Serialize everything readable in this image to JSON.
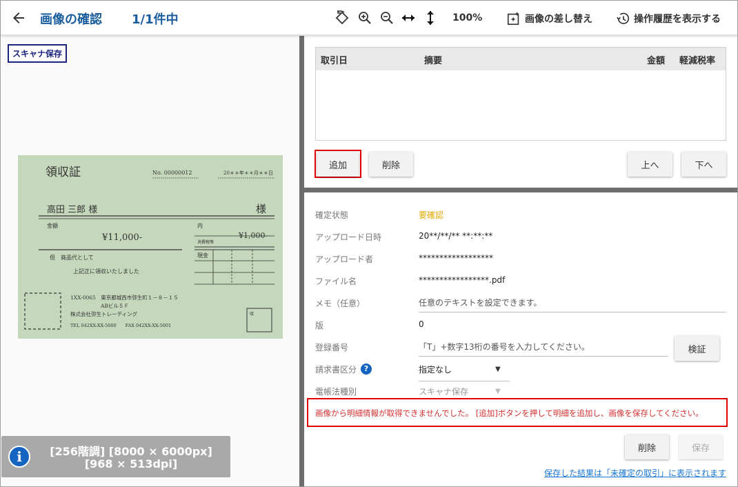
{
  "header": {
    "title": "画像の確認",
    "count": "1/1件中",
    "zoom": "100%",
    "replace_label": "画像の差し替え",
    "history_label": "操作履歴を表示する"
  },
  "left": {
    "badge": "スキャナ保存",
    "receipt": {
      "title": "領収証",
      "number": "No. 00000012",
      "date": "20＊＊年＊＊月＊＊日",
      "recipient": "高田 三郎 様",
      "honorific": "様",
      "amount_label": "金額",
      "amount": "¥11,000-",
      "inner_label": "内",
      "tax_label": "消費税等",
      "tax_amount": "¥1,000-",
      "cash_label": "現金",
      "proviso": "但　商品代として",
      "received": "上記正に領収いたしました",
      "address": "1XX-0065　東京都城西市弥生町１－８－１５",
      "building": "ABビル５Ｆ",
      "company": "株式会社弥生トレーディング",
      "tel": "TEL 042XX-XX-5000　　FAX 042XX-XX-5001",
      "stamp": "収"
    },
    "info_line1": "[256階調] [8000 × 6000px]",
    "info_line2": "[968 × 513dpi]"
  },
  "detail": {
    "columns": {
      "date": "取引日",
      "summary": "摘要",
      "amount": "金額",
      "tax_rate": "軽減税率"
    },
    "add_label": "追加",
    "delete_label": "削除",
    "up_label": "上へ",
    "down_label": "下へ"
  },
  "form": {
    "status_label": "確定状態",
    "status_value": "要確認",
    "upload_date_label": "アップロード日時",
    "upload_date_value": "20**/**/** **:**:**",
    "uploader_label": "アップロード者",
    "uploader_value": "******************",
    "filename_label": "ファイル名",
    "filename_value": "*****************.pdf",
    "memo_label": "メモ（任意）",
    "memo_placeholder": "任意のテキストを設定できます。",
    "version_label": "版",
    "version_value": "0",
    "reg_label": "登録番号",
    "reg_placeholder": "「T」+数字13桁の番号を入力してください。",
    "verify_label": "検証",
    "invoice_type_label": "請求書区分",
    "invoice_type_value": "指定なし",
    "ebook_label": "電帳法種別",
    "ebook_value": "スキャナ保存",
    "error_message": "画像から明細情報が取得できませんでした。 [追加]ボタンを押して明細を追加し、画像を保存してください。",
    "delete_label": "削除",
    "save_label": "保存",
    "footer_link": "保存した結果は「未確定の取引」に表示されます"
  },
  "colors": {
    "accent": "#1a5d9e",
    "error": "#e00000",
    "status": "#e0a800",
    "link": "#1976d2"
  }
}
